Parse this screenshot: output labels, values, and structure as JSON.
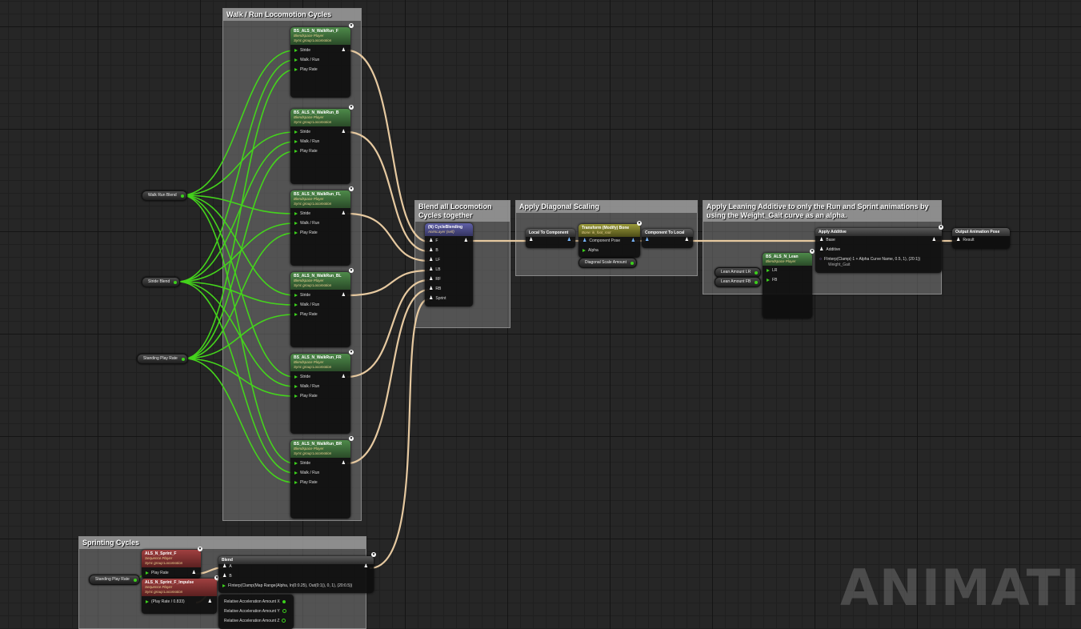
{
  "comments": {
    "walk_run": "Walk / Run Locomotion Cycles",
    "blend_all": "Blend all Locomotion Cycles together",
    "diagonal": "Apply Diagonal Scaling",
    "leaning": "Apply Leaning Additive to only the Run and Sprint animations by using the Weight_Gait curve as an alpha.",
    "sprinting": "Sprinting Cycles"
  },
  "variables": {
    "walk_run_blend": "Walk Run Blend",
    "stride_blend": "Stride Blend",
    "standing_play_rate": "Standing Play Rate",
    "standing_play_rate_2": "Standing Play Rate",
    "lean_amount_lr": "Lean Amount LR",
    "lean_amount_fb": "Lean Amount FB"
  },
  "blendspace_nodes": [
    {
      "title": "BS_ALS_N_WalkRun_F",
      "sub1": "Blendspace Player",
      "sub2": "Sync group:Locomotion",
      "pins": [
        "Stride",
        "Walk / Run",
        "Play Rate"
      ]
    },
    {
      "title": "BS_ALS_N_WalkRun_B",
      "sub1": "Blendspace Player",
      "sub2": "Sync group:Locomotion",
      "pins": [
        "Stride",
        "Walk / Run",
        "Play Rate"
      ]
    },
    {
      "title": "BS_ALS_N_WalkRun_FL",
      "sub1": "Blendspace Player",
      "sub2": "Sync group:Locomotion",
      "pins": [
        "Stride",
        "Walk / Run",
        "Play Rate"
      ]
    },
    {
      "title": "BS_ALS_N_WalkRun_BL",
      "sub1": "Blendspace Player",
      "sub2": "Sync group:Locomotion",
      "pins": [
        "Stride",
        "Walk / Run",
        "Play Rate"
      ]
    },
    {
      "title": "BS_ALS_N_WalkRun_FR",
      "sub1": "Blendspace Player",
      "sub2": "Sync group:Locomotion",
      "pins": [
        "Stride",
        "Walk / Run",
        "Play Rate"
      ]
    },
    {
      "title": "BS_ALS_N_WalkRun_BR",
      "sub1": "Blendspace Player",
      "sub2": "Sync group:Locomotion",
      "pins": [
        "Stride",
        "Walk / Run",
        "Play Rate"
      ]
    }
  ],
  "cycle_blending": {
    "title": "(N) CycleBlending",
    "sub": "AnimLayer (self)",
    "pins": [
      "F",
      "B",
      "LF",
      "LB",
      "RF",
      "RB",
      "Sprint"
    ]
  },
  "local_to_component": "Local To Component",
  "transform_bone": {
    "title": "Transform (Modify) Bone",
    "sub": "Bone: ik_foot_root",
    "pins": [
      "Component Pose",
      "Alpha"
    ]
  },
  "diagonal_scale": "Diagonal Scale Amount",
  "component_to_local": "Component To Local",
  "lean_node": {
    "title": "BS_ALS_N_Lean",
    "sub": "Blendspace Player",
    "pins": [
      "LR",
      "FB"
    ]
  },
  "apply_additive": {
    "title": "Apply Additive",
    "pins": [
      "Base",
      "Additive"
    ],
    "alpha_expr": "FInterp(Clamp(-1 + Alpha Curve Name, 0.5, 1), (20:1))",
    "alpha_curve": "Weight_Gait"
  },
  "output_pose": {
    "title": "Output Animation Pose",
    "pin": "Result"
  },
  "sprint_f": {
    "title": "ALS_N_Sprint_F",
    "sub1": "Sequence Player",
    "sub2": "Sync group:Locomotion",
    "pin": "Play Rate"
  },
  "sprint_impulse": {
    "title": "ALS_N_Sprint_F_Impulse",
    "sub1": "Sequence Player",
    "sub2": "Sync group:Locomotion",
    "pin": "(Play Rate / 0.833)"
  },
  "blend": {
    "title": "Blend",
    "pins": [
      "A",
      "B"
    ],
    "alpha_expr": "FInterp(Clamp(Map Range(Alpha, In(0:0.25), Out(0:1)), 0, 1), (20:0.5))"
  },
  "rel_accel": [
    "Relative Acceleration Amount X",
    "Relative Acceleration Amount Y",
    "Relative Acceleration Amount Z"
  ],
  "watermark": "ANIMATION",
  "colors": {
    "float_wire": "#44d41c",
    "pose_wire": "#e6c9a0",
    "blendspace_header": "#4e8a4a",
    "sequence_header": "#a04040",
    "bone_header": "#9a9a3a",
    "layer_header": "#6060a8"
  }
}
